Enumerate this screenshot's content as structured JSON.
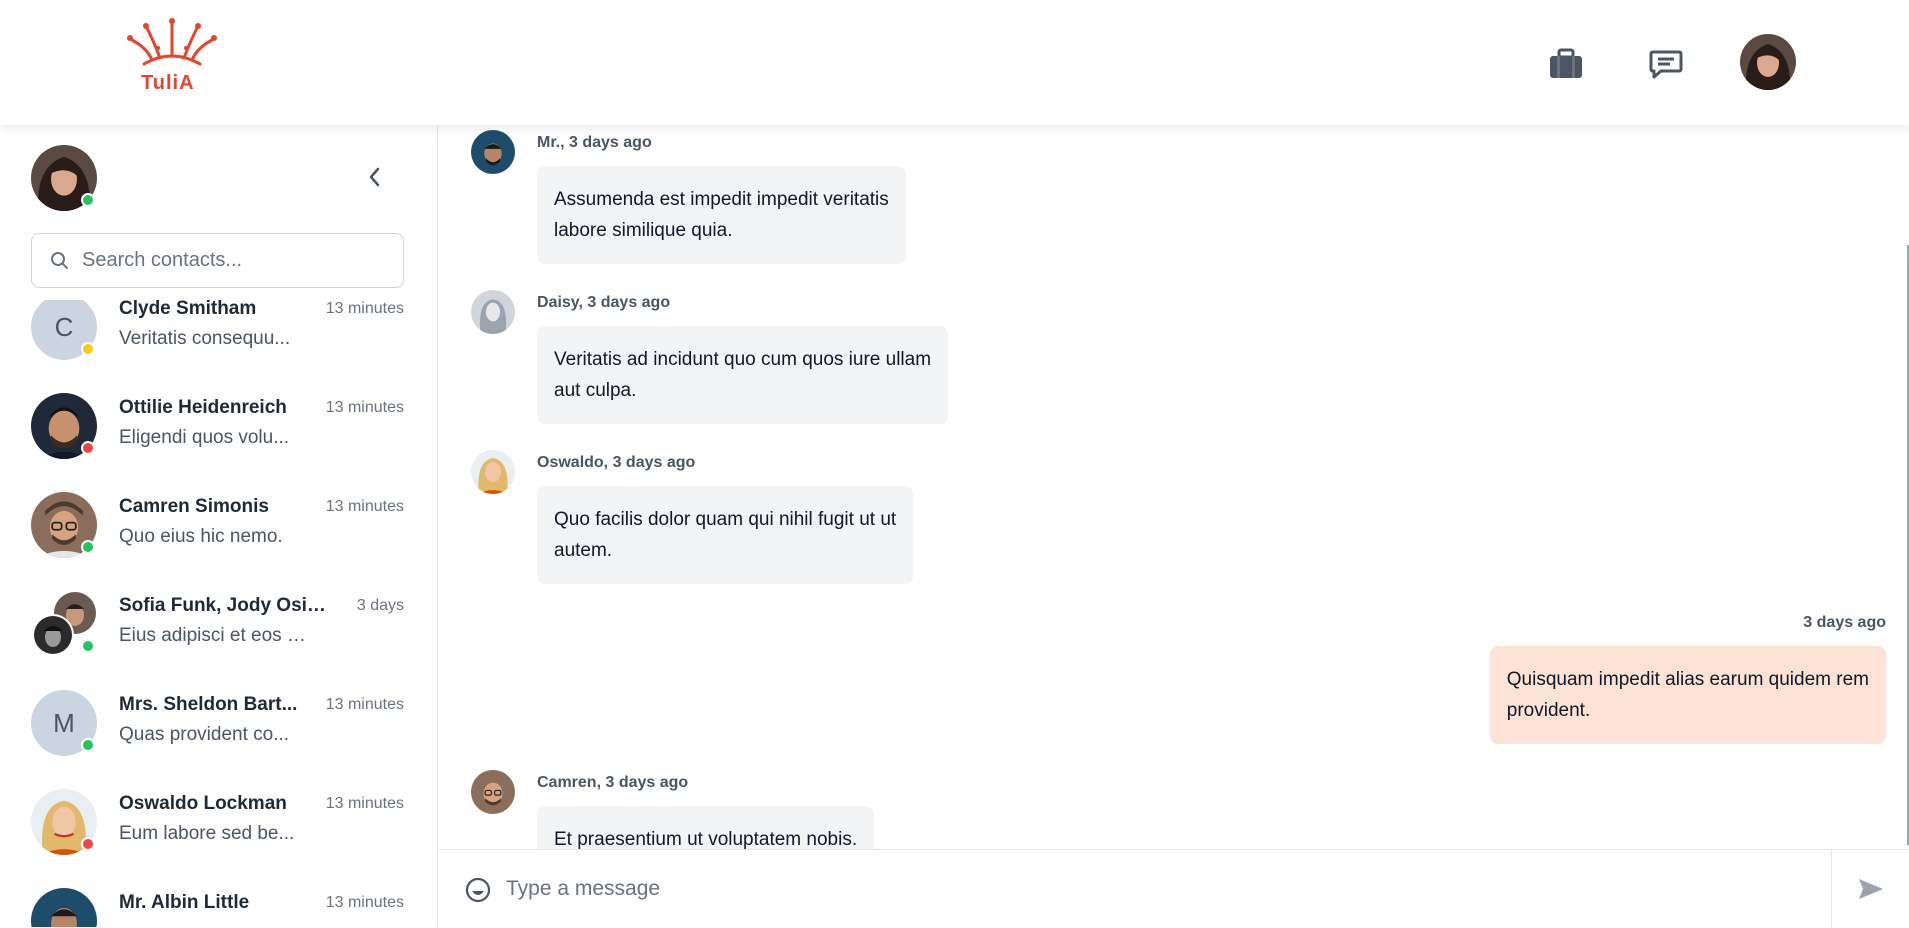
{
  "app": {
    "brand": "TuliA",
    "accent_color": "#e8432b"
  },
  "header": {
    "icons": [
      "briefcase-icon",
      "chat-icon"
    ],
    "user_avatar": "user-avatar"
  },
  "sidebar": {
    "search_placeholder": "Search contacts...",
    "contacts": [
      {
        "name": "Clyde Smitham",
        "time": "13 minutes",
        "preview": "Veritatis consequu...",
        "avatar": "letter",
        "letter": "C",
        "status": "away"
      },
      {
        "name": "Ottilie Heidenreich",
        "time": "13 minutes",
        "preview": "Eligendi quos volu...",
        "avatar": "photo",
        "status": "busy"
      },
      {
        "name": "Camren Simonis",
        "time": "13 minutes",
        "preview": "Quo eius hic nemo.",
        "avatar": "photo",
        "status": "online"
      },
      {
        "name": "Sofia Funk, Jody Osin...",
        "time": "3 days",
        "preview": "Eius adipisci et eos at ...",
        "avatar": "group",
        "status": "online"
      },
      {
        "name": "Mrs. Sheldon Bart...",
        "time": "13 minutes",
        "preview": "Quas provident co...",
        "avatar": "letter",
        "letter": "M",
        "status": "online"
      },
      {
        "name": "Oswaldo Lockman",
        "time": "13 minutes",
        "preview": "Eum labore sed be...",
        "avatar": "photo",
        "status": "busy"
      },
      {
        "name": "Mr. Albin Little",
        "time": "13 minutes",
        "preview": "",
        "avatar": "photo",
        "status": "online"
      }
    ]
  },
  "chat": {
    "messages": [
      {
        "meta": "Mr., 3 days ago",
        "text_lines": [
          "Assumenda est impedit impedit veritatis",
          "labore similique quia."
        ],
        "mine": false
      },
      {
        "meta": "Daisy, 3 days ago",
        "text_lines": [
          "Veritatis ad incidunt quo cum quos iure ullam",
          "aut culpa."
        ],
        "mine": false
      },
      {
        "meta": "Oswaldo, 3 days ago",
        "text_lines": [
          "Quo facilis dolor quam qui nihil fugit ut ut",
          "autem."
        ],
        "mine": false
      },
      {
        "meta": "3 days ago",
        "text_lines": [
          "Quisquam impedit alias earum quidem rem",
          "provident."
        ],
        "mine": true
      },
      {
        "meta": "Camren, 3 days ago",
        "text_lines": [
          "Et praesentium ut voluptatem nobis."
        ],
        "mine": false
      }
    ]
  },
  "composer": {
    "placeholder": "Type a message"
  },
  "colors": {
    "online": "#22c55e",
    "away": "#facc15",
    "busy": "#ef4444",
    "own_bubble": "#fde3d6",
    "other_bubble": "#f3f4f6"
  }
}
